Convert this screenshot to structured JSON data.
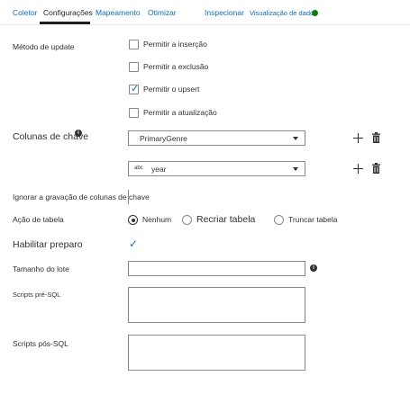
{
  "tabs": [
    {
      "label": "Coletor"
    },
    {
      "label": "Configurações"
    },
    {
      "label": "Mapeamento"
    },
    {
      "label": "Otimizar"
    },
    {
      "label": "Inspecionar"
    },
    {
      "label": "Visualização de dados"
    }
  ],
  "update_method": {
    "label": "Método de update",
    "options": [
      {
        "label": "Permitir a inserção",
        "checked": false
      },
      {
        "label": "Permitir a exclusão",
        "checked": false
      },
      {
        "label": "Permitir o upsert",
        "checked": true
      },
      {
        "label": "Permitir a atualização",
        "checked": false
      }
    ]
  },
  "key_columns": {
    "label": "Colunas de chave",
    "rows": [
      {
        "value": "PrimaryGenre",
        "type_icon": ""
      },
      {
        "value": "year",
        "type_icon": "abc"
      }
    ]
  },
  "skip_key_write": {
    "label": "Ignorar a gravação de colunas de chave"
  },
  "table_action": {
    "label": "Ação de tabela",
    "options": [
      {
        "label": "Nenhum",
        "selected": true
      },
      {
        "label": "Recriar tabela",
        "selected": false
      },
      {
        "label": "Truncar tabela",
        "selected": false
      }
    ]
  },
  "enable_staging": {
    "label": "Habilitar preparo",
    "checked": true
  },
  "batch_size": {
    "label": "Tamanho do lote",
    "value": ""
  },
  "pre_sql": {
    "label": "Scripts pré-SQL",
    "value": ""
  },
  "post_sql": {
    "label": "Scripts pós-SQL",
    "value": ""
  }
}
